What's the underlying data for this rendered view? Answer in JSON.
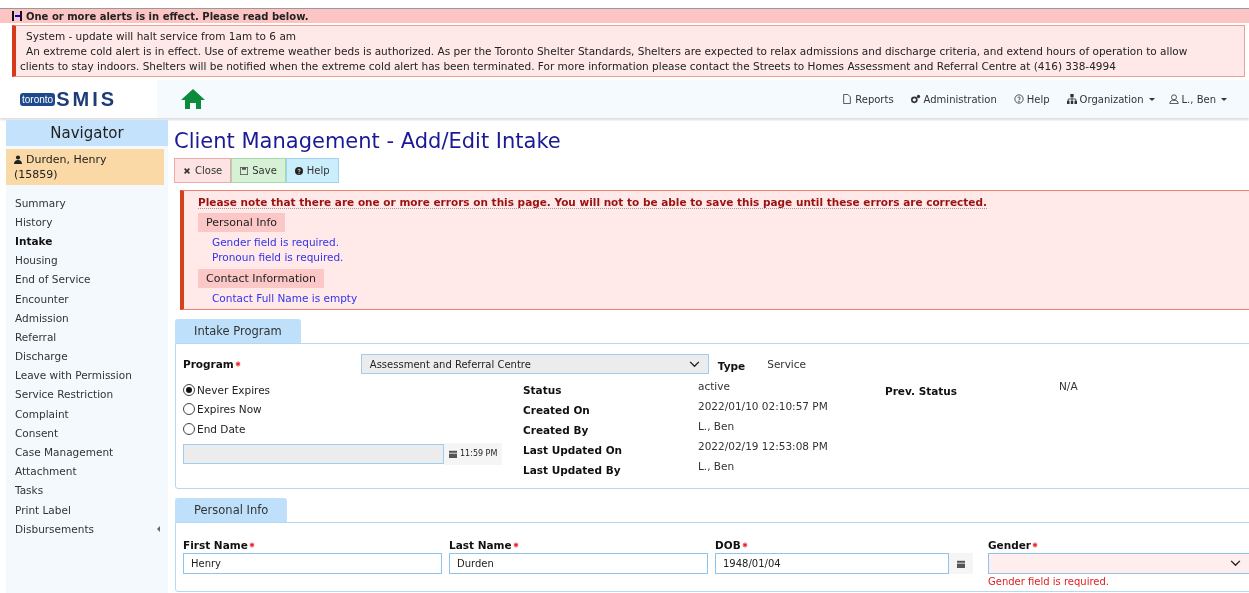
{
  "alert_bar": {
    "expanded": true,
    "text": "One or more alerts is in effect. Please read below."
  },
  "alerts": [
    "System - update will halt service from 1am to 6 am",
    "An extreme cold alert is in effect. Use of extreme weather beds is authorized. As per the Toronto Shelter Standards, Shelters are expected to relax admissions and discharge criteria, and extend hours of operation to allow clients to stay indoors. Shelters will be notified when the extreme cold alert has been terminated. For more information please contact the Streets to Homes Assessment and Referral Centre at (416) 338-4994"
  ],
  "logo": {
    "badge": "toronto",
    "name": "SMIS"
  },
  "nav": [
    {
      "label": "Reports",
      "kind": "reports",
      "dropdown": false
    },
    {
      "label": "Administration",
      "kind": "admin",
      "dropdown": false
    },
    {
      "label": "Help",
      "kind": "help",
      "dropdown": false
    },
    {
      "label": "Organization",
      "kind": "org",
      "dropdown": true
    },
    {
      "label": "L., Ben",
      "kind": "user",
      "dropdown": true
    }
  ],
  "sidebar": {
    "title": "Navigator",
    "client": {
      "name": "Durden, Henry",
      "id": "(15859)"
    },
    "items": [
      {
        "label": "Summary",
        "selected": false,
        "submenu": false
      },
      {
        "label": "History",
        "selected": false,
        "submenu": false
      },
      {
        "label": "Intake",
        "selected": true,
        "submenu": false
      },
      {
        "label": "Housing",
        "selected": false,
        "submenu": false
      },
      {
        "label": "End of Service",
        "selected": false,
        "submenu": false
      },
      {
        "label": "Encounter",
        "selected": false,
        "submenu": false
      },
      {
        "label": "Admission",
        "selected": false,
        "submenu": false
      },
      {
        "label": "Referral",
        "selected": false,
        "submenu": false
      },
      {
        "label": "Discharge",
        "selected": false,
        "submenu": false
      },
      {
        "label": "Leave with Permission",
        "selected": false,
        "submenu": false
      },
      {
        "label": "Service Restriction",
        "selected": false,
        "submenu": false
      },
      {
        "label": "Complaint",
        "selected": false,
        "submenu": false
      },
      {
        "label": "Consent",
        "selected": false,
        "submenu": false
      },
      {
        "label": "Case Management",
        "selected": false,
        "submenu": false
      },
      {
        "label": "Attachment",
        "selected": false,
        "submenu": false
      },
      {
        "label": "Tasks",
        "selected": false,
        "submenu": false
      },
      {
        "label": "Print Label",
        "selected": false,
        "submenu": false
      },
      {
        "label": "Disbursements",
        "selected": false,
        "submenu": true
      }
    ]
  },
  "title": "Client Management - Add/Edit Intake",
  "toolbar": [
    {
      "label": "Close",
      "kind": "close"
    },
    {
      "label": "Save",
      "kind": "save"
    },
    {
      "label": "Help",
      "kind": "help"
    }
  ],
  "errors": {
    "message": "Please note that there are one or more errors on this page. You will not to be able to save this page until these errors are corrected.",
    "groups": [
      {
        "title": "Personal Info",
        "items": [
          "Gender field is required.",
          "Pronoun field is required."
        ]
      },
      {
        "title": "Contact Information",
        "items": [
          "Contact Full Name is empty"
        ]
      }
    ]
  },
  "intake_program": {
    "tab": "Intake Program",
    "program_label": "Program",
    "program_required": true,
    "program_value": "Assessment and Referral Centre",
    "type_label": "Type",
    "type_value": "Service",
    "expiry": [
      {
        "label": "Never Expires",
        "selected": true
      },
      {
        "label": "Expires Now",
        "selected": false
      },
      {
        "label": "End Date",
        "selected": false
      }
    ],
    "time": "11:59 PM",
    "details": [
      {
        "label": "Status",
        "value": "active"
      },
      {
        "label": "Created On",
        "value": "2022/01/10 02:10:57 PM"
      },
      {
        "label": "Created By",
        "value": "L., Ben"
      },
      {
        "label": "Last Updated On",
        "value": "2022/02/19 12:53:08 PM"
      },
      {
        "label": "Last Updated By",
        "value": "L., Ben"
      }
    ],
    "prev_status_label": "Prev. Status",
    "prev_status_value": "N/A"
  },
  "personal_info": {
    "tab": "Personal Info",
    "fields": [
      {
        "label": "First Name",
        "required": true,
        "kind": "text",
        "value": "Henry"
      },
      {
        "label": "Last Name",
        "required": true,
        "kind": "text",
        "value": "Durden"
      },
      {
        "label": "DOB",
        "required": true,
        "kind": "date",
        "value": "1948/01/04"
      },
      {
        "label": "Gender",
        "required": true,
        "kind": "select",
        "error": "Gender field is required."
      }
    ]
  }
}
